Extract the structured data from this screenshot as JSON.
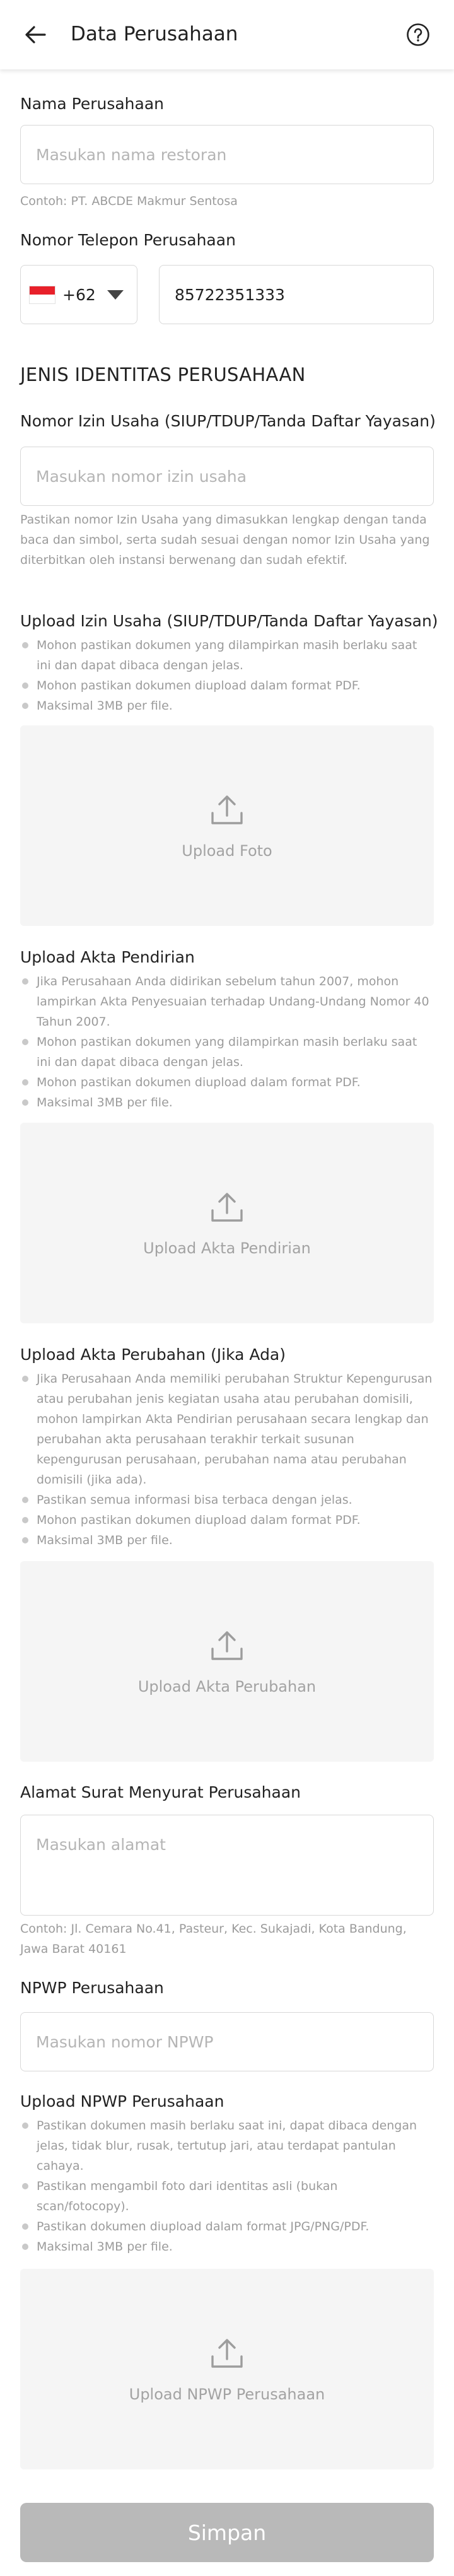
{
  "header": {
    "title": "Data Perusahaan"
  },
  "company_name": {
    "label": "Nama Perusahaan",
    "placeholder": "Masukan nama restoran",
    "hint": "Contoh: PT. ABCDE Makmur Sentosa"
  },
  "phone": {
    "label": "Nomor Telepon Perusahaan",
    "country_code": "+62",
    "flag": "indonesia-flag",
    "value": "85722351333"
  },
  "identity_section": {
    "heading": "JENIS IDENTITAS PERUSAHAAN"
  },
  "permit": {
    "label": "Nomor Izin Usaha (SIUP/TDUP/Tanda Daftar Yayasan)",
    "placeholder": "Masukan nomor izin usaha",
    "hint": "Pastikan nomor Izin Usaha yang dimasukkan lengkap dengan tanda baca dan simbol, serta sudah sesuai dengan nomor Izin Usaha yang diterbitkan oleh instansi berwenang dan sudah efektif."
  },
  "permit_upload": {
    "label": "Upload Izin Usaha (SIUP/TDUP/Tanda Daftar Yayasan)",
    "notes": [
      "Mohon pastikan dokumen yang dilampirkan masih berlaku saat ini dan dapat dibaca dengan jelas.",
      "Mohon pastikan dokumen diupload dalam format PDF.",
      "Maksimal 3MB per file."
    ],
    "button": "Upload Foto"
  },
  "deed_upload": {
    "label": "Upload Akta Pendirian",
    "notes": [
      "Jika Perusahaan Anda didirikan sebelum tahun 2007, mohon lampirkan Akta Penyesuaian terhadap Undang-Undang Nomor 40 Tahun 2007.",
      "Mohon pastikan dokumen yang dilampirkan masih berlaku saat ini dan dapat dibaca dengan jelas.",
      "Mohon pastikan dokumen diupload dalam format PDF.",
      "Maksimal 3MB per file."
    ],
    "button": "Upload Akta Pendirian"
  },
  "amendment_upload": {
    "label": "Upload Akta Perubahan (Jika Ada)",
    "notes": [
      "Jika Perusahaan Anda memiliki perubahan Struktur Kepengurusan atau perubahan jenis kegiatan usaha atau perubahan domisili, mohon lampirkan Akta Pendirian perusahaan secara lengkap dan perubahan akta perusahaan terakhir terkait susunan kepengurusan perusahaan, perubahan nama atau perubahan domisili (jika ada).",
      "Pastikan semua informasi bisa terbaca dengan jelas.",
      "Mohon pastikan dokumen diupload dalam format PDF.",
      "Maksimal 3MB per file."
    ],
    "button": "Upload Akta Perubahan"
  },
  "address": {
    "label": "Alamat Surat Menyurat Perusahaan",
    "placeholder": "Masukan alamat",
    "hint": "Contoh: Jl. Cemara No.41, Pasteur, Kec. Sukajadi, Kota Bandung, Jawa Barat 40161"
  },
  "npwp": {
    "label": "NPWP Perusahaan",
    "placeholder": "Masukan nomor NPWP"
  },
  "npwp_upload": {
    "label": "Upload NPWP Perusahaan",
    "notes": [
      "Pastikan dokumen masih berlaku saat ini, dapat dibaca dengan jelas, tidak blur, rusak, tertutup jari, atau terdapat pantulan cahaya.",
      "Pastikan mengambil foto dari identitas asli (bukan scan/fotocopy).",
      "Pastikan dokumen diupload dalam format JPG/PNG/PDF.",
      "Maksimal 3MB per file."
    ],
    "button": "Upload NPWP Perusahaan"
  },
  "submit": {
    "label": "Simpan"
  },
  "colors": {
    "flag_red": "#e8202a",
    "button_disabled": "#b9b9b9",
    "upload_bg": "#f5f5f5",
    "hint_text": "#9b9b9b"
  }
}
